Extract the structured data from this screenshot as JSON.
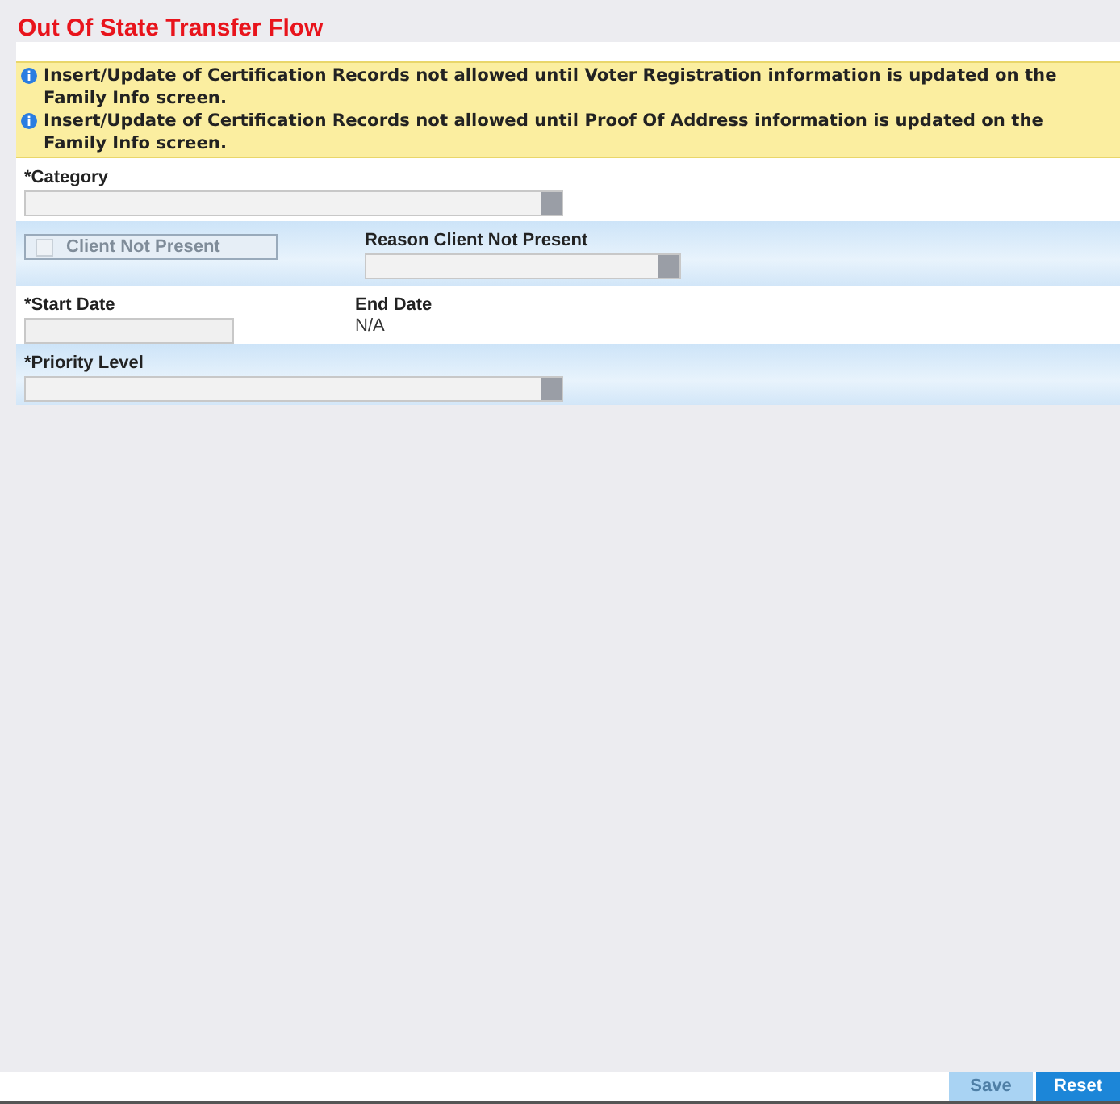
{
  "title": "Out Of State Transfer Flow",
  "messages": [
    "Insert/Update of Certification Records not allowed until Voter Registration information is updated on the Family Info screen.",
    "Insert/Update of Certification Records not allowed until Proof Of Address information is updated on the Family Info screen."
  ],
  "category": {
    "label": "*Category"
  },
  "client_not_present": {
    "label": "Client Not Present",
    "checked": false,
    "disabled": true
  },
  "reason": {
    "label": "Reason Client Not Present"
  },
  "start_date": {
    "label": "*Start Date"
  },
  "end_date": {
    "label": "End Date",
    "value": "N/A"
  },
  "priority": {
    "label": "*Priority Level"
  },
  "buttons": [
    {
      "label": "Save",
      "disabled": true
    },
    {
      "label": "Reset",
      "disabled": false
    }
  ]
}
